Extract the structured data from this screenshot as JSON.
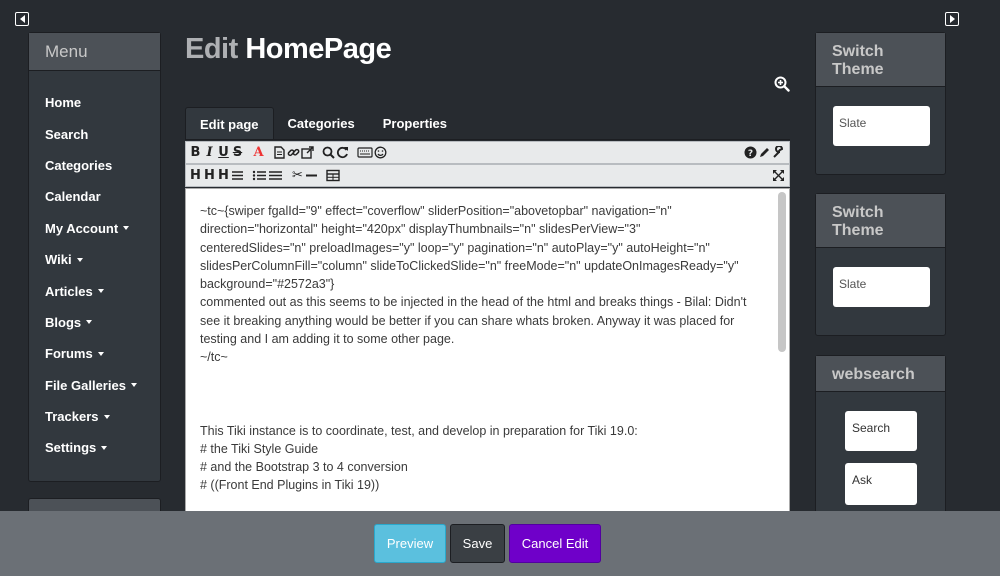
{
  "menu": {
    "title": "Menu",
    "items": [
      {
        "label": "Home",
        "dropdown": false
      },
      {
        "label": "Search",
        "dropdown": false
      },
      {
        "label": "Categories",
        "dropdown": false
      },
      {
        "label": "Calendar",
        "dropdown": false
      },
      {
        "label": "My Account",
        "dropdown": true
      },
      {
        "label": "Wiki",
        "dropdown": true
      },
      {
        "label": "Articles",
        "dropdown": true
      },
      {
        "label": "Blogs",
        "dropdown": true
      },
      {
        "label": "Forums",
        "dropdown": true
      },
      {
        "label": "File Galleries",
        "dropdown": true
      },
      {
        "label": "Trackers",
        "dropdown": true
      },
      {
        "label": "Settings",
        "dropdown": true
      }
    ]
  },
  "page": {
    "title_prefix": "Edit",
    "title_name": "HomePage"
  },
  "tabs": [
    {
      "label": "Edit page",
      "active": true
    },
    {
      "label": "Categories",
      "active": false
    },
    {
      "label": "Properties",
      "active": false
    }
  ],
  "toolbar": {
    "row1": [
      "bold-icon",
      "italic-icon",
      "underline-icon",
      "strikethrough-icon",
      "text-color-icon",
      "page-icon",
      "link-icon",
      "external-link-icon",
      "search-icon",
      "refresh-icon",
      "keyboard-icon",
      "smiley-icon",
      "help-icon",
      "pencil-icon",
      "wrench-icon"
    ],
    "row2": [
      "heading-icon",
      "list-icon",
      "cut-icon",
      "table-icon",
      "fullscreen-icon"
    ]
  },
  "editor": {
    "lines": [
      "~tc~{swiper fgalId=\"9\" effect=\"coverflow\" sliderPosition=\"abovetopbar\" navigation=\"n\"",
      "direction=\"horizontal\" height=\"420px\" displayThumbnails=\"n\" slidesPerView=\"3\"",
      "centeredSlides=\"n\" preloadImages=\"y\" loop=\"y\" pagination=\"n\" autoPlay=\"y\" autoHeight=\"n\"",
      "slidesPerColumnFill=\"column\" slideToClickedSlide=\"n\" freeMode=\"n\" updateOnImagesReady=\"y\"",
      "background=\"#2572a3\"}",
      "commented out as this seems to be injected in the head of the html and breaks things - Bilal: Didn't",
      "see it breaking anything would be better if you can share whats broken. Anyway it was placed for",
      "testing and I am adding it to some other page.",
      "~/tc~",
      "",
      "",
      "",
      "This Tiki instance is to coordinate, test, and develop in preparation for Tiki 19.0:",
      "# the Tiki Style Guide",
      "# and the Bootstrap 3 to 4 conversion",
      "# ((Front End Plugins in Tiki 19))"
    ]
  },
  "right": {
    "theme1": {
      "title": "Switch Theme",
      "value": "Slate"
    },
    "theme2": {
      "title": "Switch Theme",
      "value": "Slate"
    },
    "websearch": {
      "title": "websearch",
      "search_label": "Search",
      "ask_label": "Ask"
    }
  },
  "buttons": {
    "preview": "Preview",
    "save": "Save",
    "cancel": "Cancel Edit"
  },
  "colors": {
    "background": "#272b30",
    "panel": "#32383e",
    "preview": "#5bc0de",
    "cancel": "#6f00c9"
  }
}
